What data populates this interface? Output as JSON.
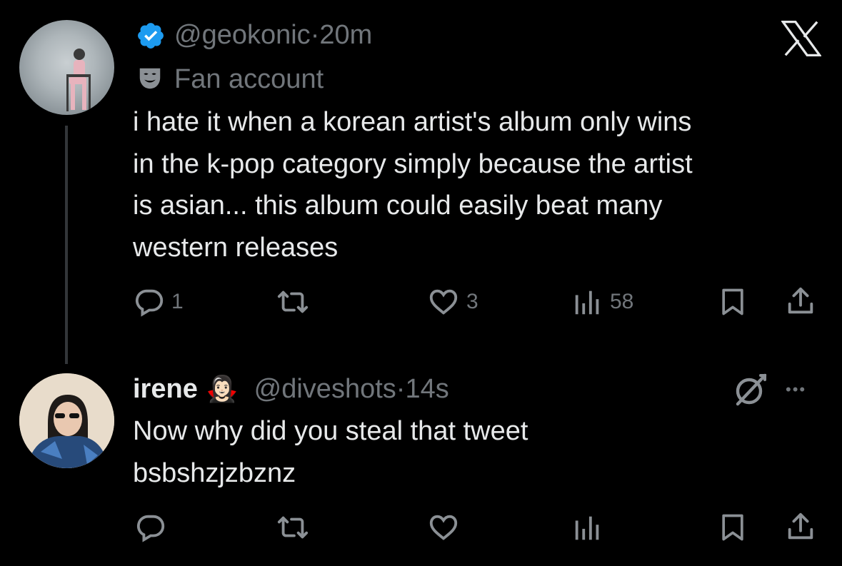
{
  "tweet1": {
    "handle": "@geokonic",
    "sep": "·",
    "time": "20m",
    "label": "Fan account",
    "lines": [
      "i hate it when a korean artist's album only wins",
      "in the k-pop category simply because the artist",
      "is asian... this album could easily beat many",
      "western releases"
    ],
    "actions": {
      "reply_count": "1",
      "retweet_count": "",
      "like_count": "3",
      "view_count": "58"
    }
  },
  "tweet2": {
    "name": "irene",
    "emoji": "🧛🏻‍♀️",
    "handle": "@diveshots",
    "sep": "·",
    "time": "14s",
    "lines": [
      "Now why did you steal that tweet",
      "bsbshzjzbznz"
    ],
    "more": "•••"
  },
  "colors": {
    "background": "#000000",
    "text": "#e7e9ea",
    "muted": "#71767b",
    "verified": "#1d9bf0"
  },
  "icons": [
    "verified-badge-icon",
    "fan-mask-icon",
    "x-logo-icon",
    "reply-icon",
    "retweet-icon",
    "like-icon",
    "views-icon",
    "bookmark-icon",
    "share-icon",
    "grok-icon",
    "more-icon"
  ]
}
